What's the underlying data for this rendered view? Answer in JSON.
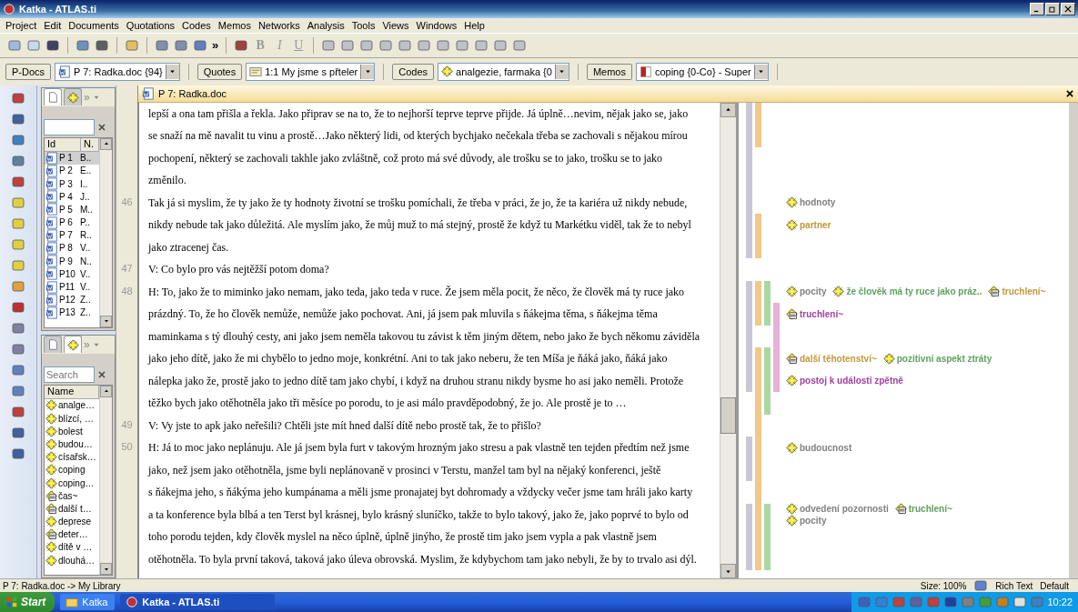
{
  "window": {
    "title": "Katka - ATLAS.ti"
  },
  "menu": [
    "Project",
    "Edit",
    "Documents",
    "Quotations",
    "Codes",
    "Memos",
    "Networks",
    "Analysis",
    "Tools",
    "Views",
    "Windows",
    "Help"
  ],
  "toolbar": {
    "overflow": "»",
    "format_buttons": [
      "B",
      "I",
      "U"
    ]
  },
  "doc_toolbar": [
    {
      "kind": "documents",
      "button": "P-Docs",
      "combo": "P 7: Radka.doc {94}"
    },
    {
      "kind": "quotations",
      "button": "Quotes",
      "combo": "1:1 My jsme s přteler"
    },
    {
      "kind": "codes",
      "button": "Codes",
      "combo": "analgezie, farmaka {0"
    },
    {
      "kind": "memos",
      "button": "Memos",
      "combo": "coping {0-Co} - Super"
    }
  ],
  "documents_pane": {
    "tabs": [
      {
        "selected": true
      },
      {
        "selected": false
      }
    ],
    "overflow": "»",
    "columns": [
      "Id",
      "N."
    ],
    "rows": [
      {
        "id": "P 1",
        "name": "B..",
        "selected": true
      },
      {
        "id": "P 2",
        "name": "E..",
        "selected": false
      },
      {
        "id": "P 3",
        "name": "I..",
        "selected": false
      },
      {
        "id": "P 4",
        "name": "J..",
        "selected": false
      },
      {
        "id": "P 5",
        "name": "M..",
        "selected": false
      },
      {
        "id": "P 6",
        "name": "P..",
        "selected": false
      },
      {
        "id": "P 7",
        "name": "R..",
        "selected": false
      },
      {
        "id": "P 8",
        "name": "V..",
        "selected": false
      },
      {
        "id": "P 9",
        "name": "N..",
        "selected": false
      },
      {
        "id": "P10",
        "name": "V..",
        "selected": false
      },
      {
        "id": "P11",
        "name": "V..",
        "selected": false
      },
      {
        "id": "P12",
        "name": "Z..",
        "selected": false
      },
      {
        "id": "P13",
        "name": "Z..",
        "selected": false
      }
    ]
  },
  "codes_pane": {
    "tabs": [
      {
        "selected": false
      },
      {
        "selected": true
      }
    ],
    "overflow": "»",
    "search": {
      "placeholder": "Search"
    },
    "columns": [
      "Name"
    ],
    "rows": [
      {
        "kind": "code",
        "name": "analge…"
      },
      {
        "kind": "code",
        "name": "blízcí, …"
      },
      {
        "kind": "code",
        "name": "bolest"
      },
      {
        "kind": "code",
        "name": "budou…"
      },
      {
        "kind": "code",
        "name": "císařsk…"
      },
      {
        "kind": "code",
        "name": "coping"
      },
      {
        "kind": "code",
        "name": "coping…"
      },
      {
        "kind": "memo_code",
        "name": "čas~"
      },
      {
        "kind": "memo_code",
        "name": "další t…"
      },
      {
        "kind": "code",
        "name": "deprese"
      },
      {
        "kind": "memo_code",
        "name": "deter…"
      },
      {
        "kind": "code",
        "name": "dítě v …"
      },
      {
        "kind": "code",
        "name": "dlouhá…"
      }
    ]
  },
  "document": {
    "title": "P 7: Radka.doc",
    "paragraphs": [
      {
        "lines": [
          "lepší a ona tam přišla a řekla. Jako připrav se na to, že to nejhorší teprve teprve přijde. Já úplně…nevim, nějak jako se, jako",
          "se snaží na mě navalit  tu vinu a prostě…Jako některý lidi, od kterých bychjako nečekala třeba se zachovali s nějakou mírou",
          "pochopení, některý se zachovali takhle jako zvláštně, což proto má své důvody, ale trošku se to jako, trošku se to jako",
          "změnilo."
        ]
      },
      {
        "number": "46",
        "lines": [
          "Tak já si myslim, že ty jako že ty hodnoty životní se trošku pomíchali, že třeba v práci, že jo, že ta kariéra už  nikdy nebude,",
          "nikdy nebude tak jako důležitá. Ale myslím jako, že můj muž to má stejný, prostě že když tu Markétku viděl, tak že to nebyl",
          "jako ztracenej čas."
        ]
      },
      {
        "number": "47",
        "lines": [
          "V: Co bylo pro vás nejtěžší potom doma?"
        ]
      },
      {
        "number": "48",
        "lines": [
          "H: To, jako že to miminko jako nemam, jako teda, jako teda v ruce. Že jsem měla pocit, že něco, že člověk má ty ruce jako",
          "prázdný. To, že ho člověk nemůže, nemůže jako pochovat. Ani, já jsem pak mluvila s ňákejma těma, s ňákejma těma",
          "maminkama s tý dlouhý cesty, ani jako jsem neměla takovou tu závist k těm jiným dětem, nebo jako že bych někomu záviděla",
          "jako jeho dítě, jako že mi chybělo to jedno moje, konkrétní. Ani to tak jako neberu, že ten Míša je ňáká jako, ňáká jako",
          "nálepka jako že, prostě jako to jedno dítě tam jako chybí, i když na druhou stranu nikdy bysme ho asi jako neměli. Protože",
          "těžko bych jako otěhotněla jako tři měsíce po porodu, to je asi málo pravděpodobný, že jo. Ale prostě je to …"
        ]
      },
      {
        "number": "49",
        "lines": [
          "V: Vy jste to apk jako neřešili? Chtěli jste mít hned další dítě nebo prostě tak, že to přišlo?"
        ]
      },
      {
        "number": "50",
        "lines": [
          "H: Já to moc jako neplánuju. Ale já jsem byla furt v takovým hrozným jako stresu a pak vlastně ten tejden předtím než jsme",
          "jako, než jsem jako otěhotněla, jsme byli neplánovaně v prosinci v Terstu, manžel tam byl na nějaký konferenci, ještě",
          "s ňákejma jeho, s ňákýma jeho kumpánama a měli jsme pronajatej byt dohromady a vždycky večer jsme tam hráli jako karty",
          "a ta konference byla blbá a ten Terst byl krásnej, bylo krásný sluníčko, takže to bylo takový, jako že, jako poprvé to bylo od",
          "toho porodu tejden, kdy člověk myslel na něco úplně, úplně jinýho, že prostě tim jako jsem vypla a pak vlastně jsem",
          "otěhotněla. To byla první taková, taková jako úleva obrovská. Myslim, že kdybychom tam jako nebyli, že by to trvalo asi dýl."
        ]
      }
    ]
  },
  "margin": {
    "rows": [
      {
        "bars": [
          {
            "color": "#c8c8d4"
          },
          {
            "color": "#f0c888"
          }
        ]
      },
      {
        "bars": [
          {
            "color": "#c8c8d4"
          },
          {
            "color": "#f0c888"
          }
        ]
      },
      {
        "bars": [
          {
            "color": "#c8c8d4"
          }
        ]
      },
      {
        "bars": [
          {
            "color": "#c8c8d4"
          }
        ]
      },
      {
        "bars": [
          {
            "color": "#c8c8d4"
          }
        ],
        "code_lines": [
          [
            {
              "kind": "code",
              "label": "hodnoty",
              "color": "#808080"
            }
          ]
        ]
      },
      {
        "bars": [
          {
            "color": "#c8c8d4"
          },
          {
            "color": "#f0c888"
          }
        ],
        "code_lines": [
          [
            {
              "kind": "code",
              "label": "partner",
              "color": "#c09838"
            }
          ]
        ]
      },
      {
        "bars": [
          {
            "color": "#c8c8d4"
          },
          {
            "color": "#f0c888"
          }
        ]
      },
      {},
      {
        "bars": [
          {
            "color": "#c8c8d4"
          },
          {
            "color": "#f0c888"
          },
          {
            "color": "#a8d8a0"
          }
        ],
        "code_lines": [
          [
            {
              "kind": "code",
              "label": "pocity",
              "color": "#808080"
            },
            {
              "kind": "code",
              "label": "že člověk má ty ruce jako práz..",
              "color": "#60a060"
            },
            {
              "kind": "memo_code",
              "label": "truchlení~",
              "color": "#c09838"
            }
          ]
        ]
      },
      {
        "bars": [
          {
            "color": "#c8c8d4"
          },
          {
            "color": "#f0c888"
          },
          {
            "color": "#a8d8a0"
          },
          {
            "color": "#e8b0d8"
          }
        ],
        "code_lines": [
          [
            {
              "kind": "memo_code",
              "label": "truchlení~",
              "color": "#a040a0"
            }
          ]
        ]
      },
      {
        "bars": [
          {
            "color": "#c8c8d4"
          },
          {
            "color": "#e8b0d8"
          }
        ]
      },
      {
        "bars": [
          {
            "color": "#c8c8d4"
          },
          {
            "color": "#f0c888"
          },
          {
            "color": "#a8d8a0"
          },
          {
            "color": "#e8b0d8"
          }
        ],
        "code_lines": [
          [
            {
              "kind": "memo_code",
              "label": "další těhotenství~",
              "color": "#c09838"
            },
            {
              "kind": "code",
              "label": "pozitivní aspekt ztráty",
              "color": "#60a060"
            }
          ]
        ]
      },
      {
        "bars": [
          {
            "color": "#c8c8d4"
          },
          {
            "color": "#f0c888"
          },
          {
            "color": "#a8d8a0"
          },
          {
            "color": "#e8b0d8"
          }
        ],
        "code_lines": [
          [
            {
              "kind": "code",
              "label": "postoj k události zpětně",
              "color": "#a040a0"
            }
          ]
        ]
      },
      {
        "bars": [
          {
            "color": "#f0c888"
          },
          {
            "color": "#a8d8a0"
          }
        ]
      },
      {
        "bars": [
          {
            "color": "#f0c888"
          }
        ]
      },
      {
        "bars": [
          {
            "color": "#c8c8d4"
          },
          {
            "color": "#f0c888"
          }
        ],
        "code_lines": [
          [
            {
              "kind": "code",
              "label": "budoucnost",
              "color": "#808080"
            }
          ]
        ]
      },
      {
        "bars": [
          {
            "color": "#c8c8d4"
          },
          {
            "color": "#f0c888"
          }
        ]
      },
      {
        "bars": [
          {
            "color": "#f0c888"
          }
        ]
      },
      {
        "bars": [
          {
            "color": "#c8c8d4"
          },
          {
            "color": "#f0c888"
          },
          {
            "color": "#a8d8a0"
          }
        ],
        "code_lines": [
          [
            {
              "kind": "code",
              "label": "odvedení pozornosti",
              "color": "#808080"
            },
            {
              "kind": "memo_code",
              "label": "truchlení~",
              "color": "#60a060"
            }
          ],
          [
            {
              "kind": "code",
              "label": "pocity",
              "color": "#808080"
            }
          ]
        ]
      },
      {
        "bars": [
          {
            "color": "#c8c8d4"
          },
          {
            "color": "#f0c888"
          },
          {
            "color": "#a8d8a0"
          }
        ]
      },
      {
        "bars": [
          {
            "color": "#c8c8d4"
          },
          {
            "color": "#f0c888"
          },
          {
            "color": "#a8d8a0"
          }
        ]
      }
    ]
  },
  "status_bar": {
    "path": "P 7: Radka.doc -> My Library",
    "size": "Size: 100%",
    "format": "Rich Text",
    "style": "Default"
  },
  "taskbar": {
    "start": "Start",
    "items": [
      {
        "label": "Katka",
        "selected": false
      },
      {
        "label": "Katka - ATLAS.ti",
        "selected": true
      }
    ],
    "clock": "10:22"
  }
}
